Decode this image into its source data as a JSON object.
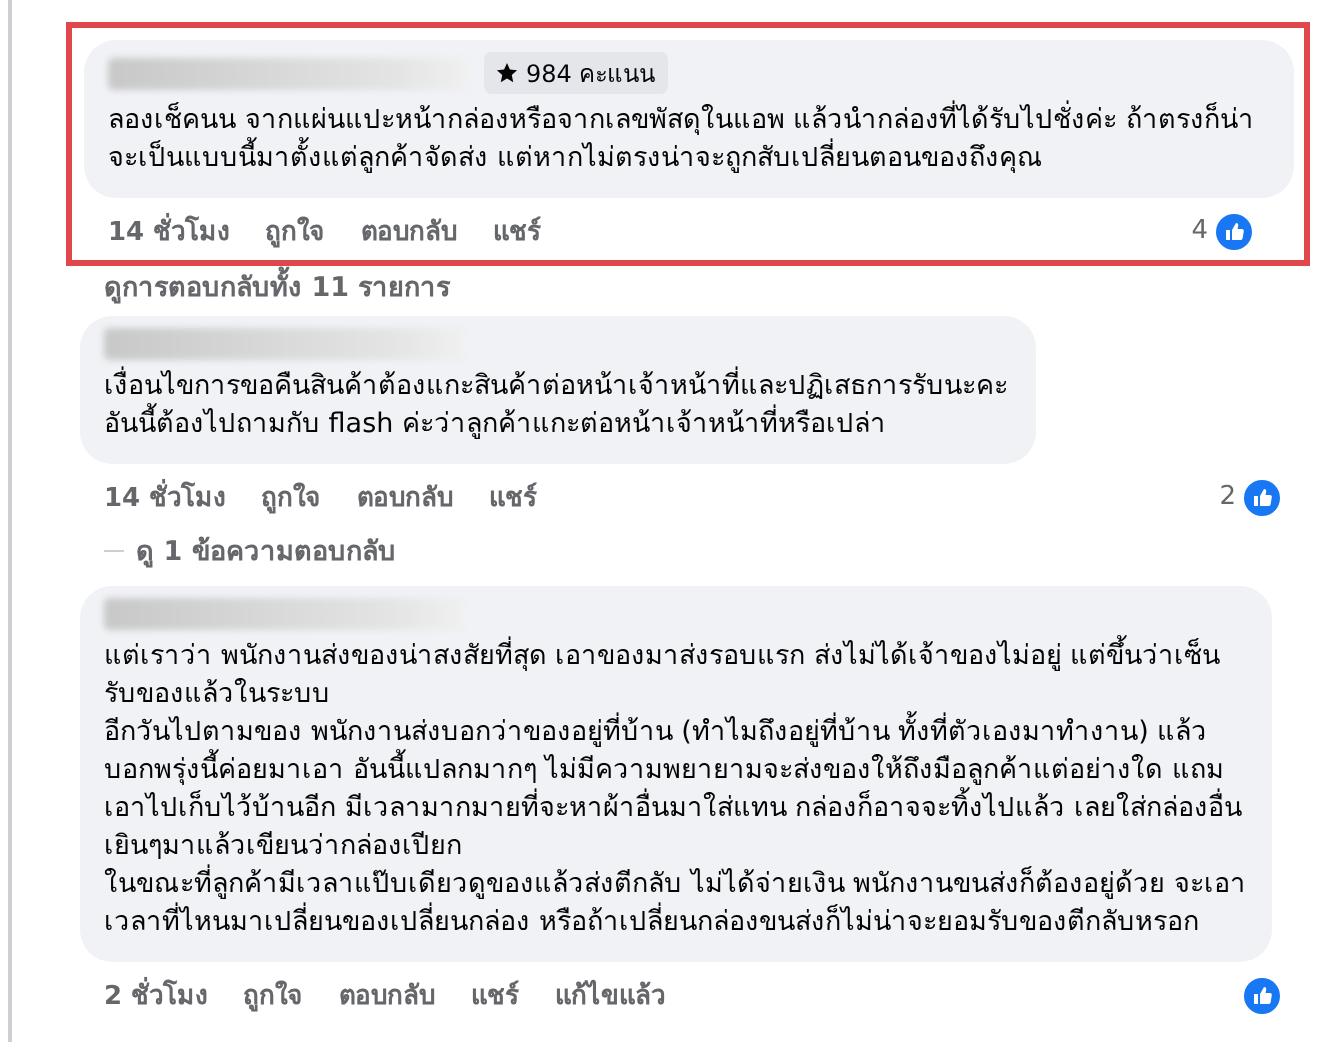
{
  "comments": [
    {
      "badge": "984 คะแนน",
      "highlighted": true,
      "paragraphs": [
        "ลองเช็คนน จากแผ่นแปะหน้ากล่องหรือจากเลขพัสดุในแอพ แล้วนำกล่องที่ได้รับไปชั่งค่ะ ถ้าตรงก็น่าจะเป็นแบบนี้มาตั้งแต่ลูกค้าจัดส่ง แต่หากไม่ตรงน่าจะถูกสับเปลี่ยนตอนของถึงคุณ"
      ],
      "actions": [
        "14 ชั่วโมง",
        "ถูกใจ",
        "ตอบกลับ",
        "แชร์"
      ],
      "like_count": "4",
      "replies_link": "ดูการตอบกลับทั้ง 11 รายการ"
    },
    {
      "highlighted": false,
      "paragraphs": [
        "เงื่อนไขการขอคืนสินค้าต้องแกะสินค้าต่อหน้าเจ้าหน้าที่และปฏิเสธการรับนะคะ อันนี้ต้องไปถามกับ flash ค่ะว่าลูกค้าแกะต่อหน้าเจ้าหน้าที่หรือเปล่า"
      ],
      "actions": [
        "14 ชั่วโมง",
        "ถูกใจ",
        "ตอบกลับ",
        "แชร์"
      ],
      "like_count": "2",
      "replies_link": "ดู 1 ข้อความตอบกลับ"
    },
    {
      "highlighted": false,
      "paragraphs": [
        "แต่เราว่า พนักงานส่งของน่าสงสัยที่สุด เอาของมาส่งรอบแรก ส่งไม่ได้เจ้าของไม่อยู่ แต่ขึ้นว่าเซ็นรับของแล้วในระบบ",
        "อีกวันไปตามของ พนักงานส่งบอกว่าของอยู่ที่บ้าน (ทำไมถึงอยู่ที่บ้าน ทั้งที่ตัวเองมาทำงาน) แล้วบอกพรุ่งนี้ค่อยมาเอา อันนี้แปลกมากๆ ไม่มีความพยายามจะส่งของให้ถึงมือลูกค้าแต่อย่างใด แถมเอาไปเก็บไว้บ้านอีก มีเวลามากมายที่จะหาผ้าอื่นมาใส่แทน กล่องก็อาจจะทิ้งไปแล้ว เลยใส่กล่องอื่นเยินๆมาแล้วเขียนว่ากล่องเปียก",
        "ในขณะที่ลูกค้ามีเวลาแป๊บเดียวดูของแล้วส่งตีกลับ ไม่ได้จ่ายเงิน พนักงานขนส่งก็ต้องอยู่ด้วย จะเอาเวลาที่ไหนมาเปลี่ยนของเปลี่ยนกล่อง หรือถ้าเปลี่ยนกล่องขนส่งก็ไม่น่าจะยอมรับของตีกลับหรอก"
      ],
      "actions": [
        "2 ชั่วโมง",
        "ถูกใจ",
        "ตอบกลับ",
        "แชร์",
        "แก้ไขแล้ว"
      ]
    }
  ]
}
